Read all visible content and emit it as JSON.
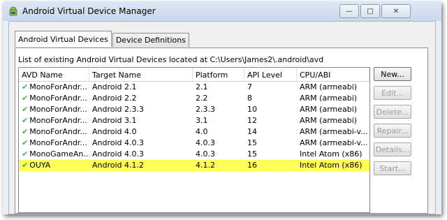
{
  "window": {
    "title": "Android Virtual Device Manager",
    "minimize": "—",
    "maximize": "□",
    "close": "✕"
  },
  "tabs": [
    {
      "label": "Android Virtual Devices",
      "active": true
    },
    {
      "label": "Device Definitions",
      "active": false
    }
  ],
  "description": "List of existing Android Virtual Devices located at C:\\Users\\James2\\.android\\avd",
  "table": {
    "columns": [
      "AVD Name",
      "Target Name",
      "Platform",
      "API Level",
      "CPU/ABI"
    ],
    "rows": [
      {
        "name": "MonoForAndr...",
        "target": "Android 2.1",
        "platform": "2.1",
        "api": "7",
        "cpu": "ARM (armeabi)"
      },
      {
        "name": "MonoForAndr...",
        "target": "Android 2.2",
        "platform": "2.2",
        "api": "8",
        "cpu": "ARM (armeabi)"
      },
      {
        "name": "MonoForAndr...",
        "target": "Android 2.3.3",
        "platform": "2.3.3",
        "api": "10",
        "cpu": "ARM (armeabi)"
      },
      {
        "name": "MonoForAndr...",
        "target": "Android 3.1",
        "platform": "3.1",
        "api": "12",
        "cpu": "ARM (armeabi)"
      },
      {
        "name": "MonoForAndr...",
        "target": "Android 4.0",
        "platform": "4.0",
        "api": "14",
        "cpu": "ARM (armeabi-v..."
      },
      {
        "name": "MonoForAndr...",
        "target": "Android 4.0.3",
        "platform": "4.0.3",
        "api": "15",
        "cpu": "ARM (armeabi-v..."
      },
      {
        "name": "MonoGameAn...",
        "target": "Android 4.0.3",
        "platform": "4.0.3",
        "api": "15",
        "cpu": "Intel Atom (x86)"
      },
      {
        "name": "OUYA",
        "target": "Android 4.1.2",
        "platform": "4.1.2",
        "api": "16",
        "cpu": "Intel Atom (x86)",
        "selected": true
      }
    ]
  },
  "buttons": {
    "new": "New...",
    "edit": "Edit...",
    "delete": "Delete...",
    "repair": "Repair...",
    "details": "Details...",
    "start": "Start..."
  },
  "colors": {
    "selection": "#fffe58",
    "check": "#4caf50"
  }
}
